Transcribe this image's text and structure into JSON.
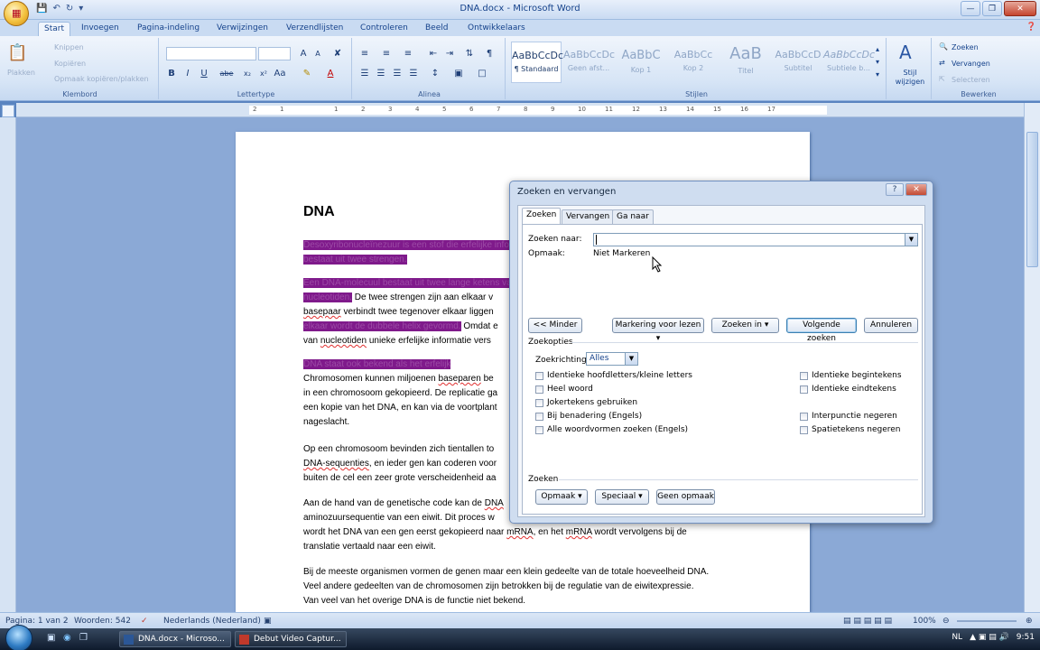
{
  "window": {
    "title": "DNA.docx - Microsoft Word"
  },
  "ribbon": {
    "tabs": [
      "Start",
      "Invoegen",
      "Pagina-indeling",
      "Verwijzingen",
      "Verzendlijsten",
      "Controleren",
      "Beeld",
      "Ontwikkelaars"
    ],
    "clipboard": {
      "paste": "Plakken",
      "cut": "Knippen",
      "copy": "Kopiëren",
      "format_painter": "Opmaak kopiëren/plakken",
      "label": "Klembord"
    },
    "font": {
      "label": "Lettertype",
      "bold": "B",
      "italic": "I",
      "underline": "U",
      "strike": "abe",
      "sub": "x₂",
      "sup": "x²",
      "grow": "A",
      "shrink": "A"
    },
    "paragraph": {
      "label": "Alinea"
    },
    "styles": {
      "label": "Stijlen",
      "items": [
        {
          "sample": "AaBbCcDc",
          "name": "¶ Standaard"
        },
        {
          "sample": "AaBbCcDc",
          "name": "Geen afst..."
        },
        {
          "sample": "AaBbC",
          "name": "Kop 1"
        },
        {
          "sample": "AaBbCc",
          "name": "Kop 2"
        },
        {
          "sample": "AaB",
          "name": "Titel"
        },
        {
          "sample": "AaBbCcD",
          "name": "Subtitel"
        },
        {
          "sample": "AaBbCcDc",
          "name": "Subtiele b..."
        }
      ],
      "change_styles": "Stijl wijzigen"
    },
    "editing": {
      "label": "Bewerken",
      "find": "Zoeken",
      "replace": "Vervangen",
      "select": "Selecteren"
    }
  },
  "ruler": {
    "ticks": [
      "2",
      "1",
      "",
      "1",
      "2",
      "3",
      "4",
      "5",
      "6",
      "7",
      "8",
      "9",
      "10",
      "11",
      "12",
      "13",
      "14",
      "15",
      "16",
      "17"
    ]
  },
  "document": {
    "heading": "DNA",
    "paragraphs": [
      {
        "runs": [
          {
            "text": "Desoxyribonucleïnezuur is een stof die erfelijke informatie bevat en",
            "hl": true
          }
        ]
      },
      {
        "runs": [
          {
            "text": "bestaat uit twee strengen.",
            "hl": true
          }
        ]
      },
      {
        "runs": [
          {
            "text": "Een DNA-molecuul bestaat uit twee lange ketens van",
            "hl": true
          }
        ]
      },
      {
        "runs": [
          {
            "text": "nucleotiden.",
            "hl": true
          },
          {
            "text": " De twee strengen zijn aan elkaar v",
            "hl": false
          }
        ]
      },
      {
        "runs": [
          {
            "text": "basepaar",
            "hl": false,
            "squig": true
          },
          {
            "text": " verbindt twee tegenover elkaar liggen",
            "hl": false
          }
        ]
      },
      {
        "runs": [
          {
            "text": "elkaar wordt de dubbele helix gevormd.",
            "hl": true
          },
          {
            "text": " Omdat e",
            "hl": false
          }
        ]
      },
      {
        "runs": [
          {
            "text": "van ",
            "hl": false
          },
          {
            "text": "nucleotiden",
            "hl": false,
            "squig": true
          },
          {
            "text": " unieke erfelijke informatie vers",
            "hl": false
          }
        ]
      },
      {
        "runs": [
          {
            "text": "DNA staat ook bekend als het erfelijk",
            "hl": true
          }
        ]
      },
      {
        "runs": [
          {
            "text": "Chromosomen kunnen miljoenen ",
            "hl": false
          },
          {
            "text": "baseparen",
            "hl": false,
            "squig": true
          },
          {
            "text": " be",
            "hl": false
          }
        ]
      },
      {
        "runs": [
          {
            "text": "in een chromosoom gekopieerd. De replicatie ga",
            "hl": false
          }
        ]
      },
      {
        "runs": [
          {
            "text": "een kopie van het DNA, en kan via de voortplant",
            "hl": false
          }
        ]
      },
      {
        "runs": [
          {
            "text": "nageslacht.",
            "hl": false
          }
        ]
      },
      {
        "runs": [
          {
            "text": "Op een chromosoom bevinden zich tientallen to",
            "hl": false
          }
        ]
      },
      {
        "runs": [
          {
            "text": "DNA-sequenties",
            "hl": false,
            "squig": true
          },
          {
            "text": ", en ieder gen kan coderen voor",
            "hl": false
          }
        ]
      },
      {
        "runs": [
          {
            "text": "buiten de cel een zeer grote verscheidenheid aa",
            "hl": false
          }
        ]
      },
      {
        "runs": [
          {
            "text": "Aan de hand van de genetische code kan de ",
            "hl": false
          },
          {
            "text": "DNA",
            "hl": false,
            "squig": true
          }
        ]
      },
      {
        "runs": [
          {
            "text": "aminozuursequentie van een eiwit. Dit proces w",
            "hl": false
          }
        ]
      },
      {
        "runs": [
          {
            "text": "wordt het DNA van een gen eerst gekopieerd naar ",
            "hl": false
          },
          {
            "text": "mRNA",
            "hl": false,
            "squig": true
          },
          {
            "text": ", en het ",
            "hl": false
          },
          {
            "text": "mRNA",
            "hl": false,
            "squig": true
          },
          {
            "text": " wordt vervolgens bij de",
            "hl": false
          }
        ]
      },
      {
        "runs": [
          {
            "text": "translatie vertaald naar een eiwit.",
            "hl": false
          }
        ]
      },
      {
        "runs": [
          {
            "text": "Bij de meeste organismen vormen de genen maar een klein gedeelte van de totale hoeveelheid DNA.",
            "hl": false
          }
        ]
      },
      {
        "runs": [
          {
            "text": "Veel andere gedeelten van de chromosomen zijn betrokken bij de regulatie van de eiwitexpressie.",
            "hl": false
          }
        ]
      },
      {
        "runs": [
          {
            "text": "Van veel van het overige DNA is de functie niet bekend.",
            "hl": false
          }
        ]
      }
    ]
  },
  "dialog": {
    "title": "Zoeken en vervangen",
    "help": "?",
    "close": "✕",
    "tabs": [
      "Zoeken",
      "Vervangen",
      "Ga naar"
    ],
    "find_label": "Zoeken naar:",
    "find_value": "",
    "format_label": "Opmaak:",
    "format_value": "Niet Markeren",
    "buttons": {
      "less": "<< Minder",
      "highlight": "Markering voor lezen",
      "find_in": "Zoeken in",
      "find_next": "Volgende zoeken",
      "cancel": "Annuleren"
    },
    "options_title": "Zoekopties",
    "direction_label": "Zoekrichting:",
    "direction_value": "Alles",
    "options_left": [
      "Identieke hoofdletters/kleine letters",
      "Heel woord",
      "Jokertekens gebruiken",
      "Bij benadering (Engels)",
      "Alle woordvormen zoeken (Engels)"
    ],
    "options_right": [
      "Identieke begintekens",
      "Identieke eindtekens",
      "Interpunctie negeren",
      "Spatietekens negeren"
    ],
    "bottom_title": "Zoeken",
    "bottom_buttons": {
      "format": "Opmaak",
      "special": "Speciaal",
      "no_format": "Geen opmaak"
    }
  },
  "statusbar": {
    "page": "Pagina: 1 van 2",
    "words": "Woorden: 542",
    "language": "Nederlands (Nederland)",
    "zoom": "100%"
  },
  "taskbar": {
    "tasks": [
      "DNA.docx - Microso...",
      "Debut Video Captur..."
    ],
    "lang": "NL",
    "time": "9:51"
  }
}
